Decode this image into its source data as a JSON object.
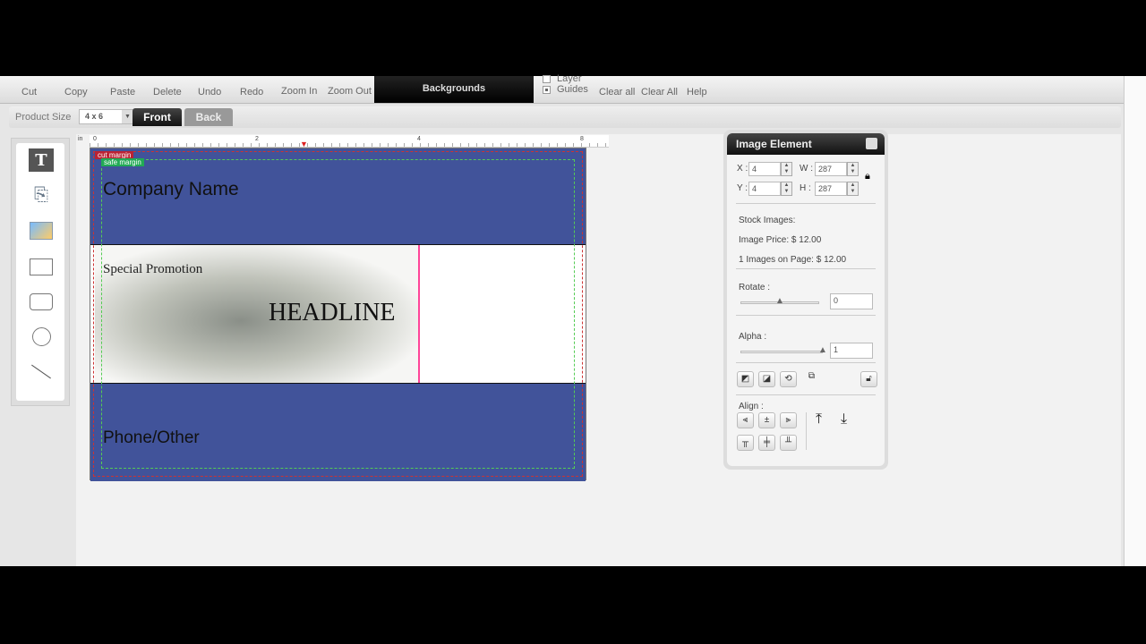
{
  "toolbar": {
    "cut": "Cut",
    "copy": "Copy",
    "paste": "Paste",
    "delete": "Delete",
    "undo": "Undo",
    "redo": "Redo",
    "zoom_in": "Zoom In",
    "zoom_out": "Zoom Out",
    "backgrounds": "Backgrounds",
    "layer": "Layer",
    "guides": "Guides",
    "clear_all": "Clear all",
    "clear_all2": "Clear All",
    "help": "Help"
  },
  "product": {
    "label": "Product Size",
    "size": "4 x 6",
    "front": "Front",
    "back": "Back"
  },
  "ruler": {
    "unit": "in",
    "t0": "0",
    "t2": "2",
    "t4": "4",
    "t8": "8"
  },
  "card": {
    "cut_margin": "cut margin",
    "safe_margin": "safe margin",
    "company": "Company Name",
    "promo": "Special Promotion",
    "headline": "HEADLINE",
    "phone": "Phone/Other",
    "blue": "#41539a"
  },
  "panel": {
    "title": "Image Element",
    "x_label": "X :",
    "x": "4",
    "y_label": "Y :",
    "y": "4",
    "w_label": "W :",
    "w": "287",
    "h_label": "H :",
    "h": "287",
    "stock": "Stock Images:",
    "price": "Image Price:  $ 12.00",
    "images_on_page": "1 Images on Page: $ 12.00",
    "rotate": "Rotate :",
    "rotate_value": "0",
    "alpha": "Alpha :",
    "alpha_value": "1",
    "align": "Align :",
    "rotate_level": 0.5,
    "alpha_level": 1.0
  }
}
